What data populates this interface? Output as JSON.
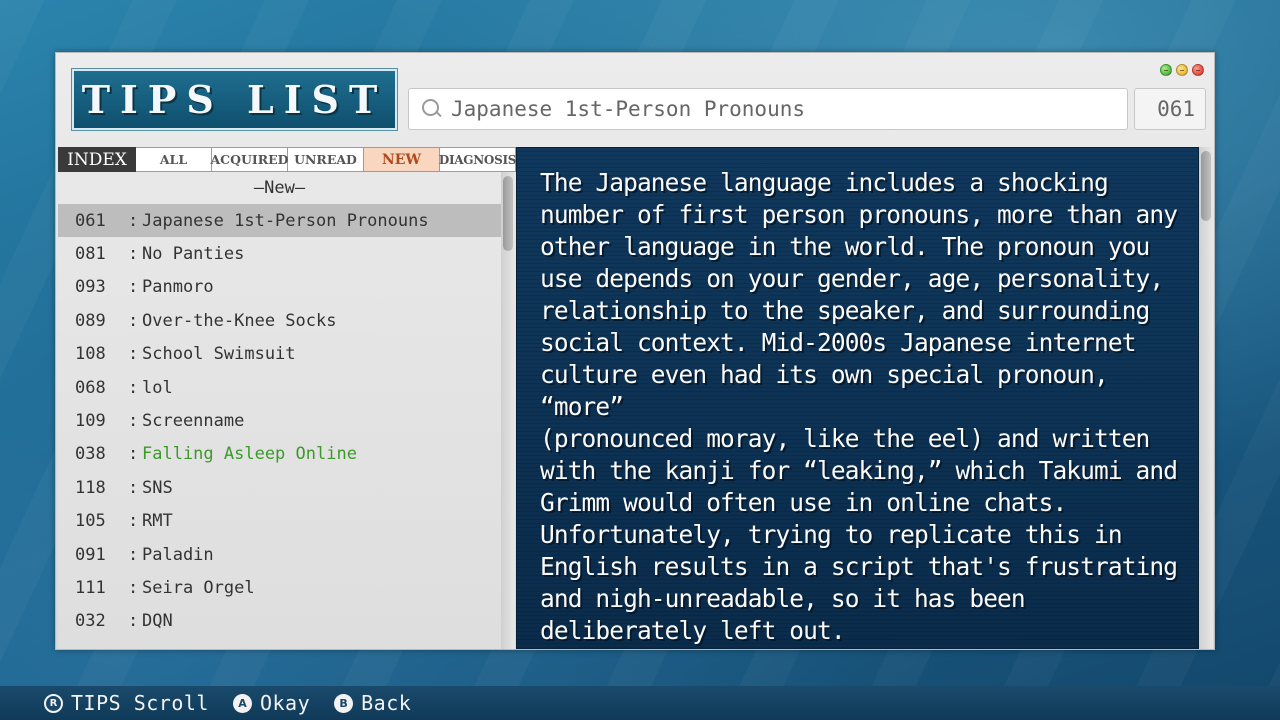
{
  "header": {
    "title": "TIPS LIST",
    "search_value": "Japanese 1st-Person Pronouns",
    "count": "061"
  },
  "tabs": [
    "INDEX",
    "ALL",
    "ACQUIRED",
    "UNREAD",
    "NEW",
    "DIAGNOSIS"
  ],
  "active_tab": "NEW",
  "list": {
    "section_header": "—New—",
    "separator": ":",
    "items": [
      {
        "num": "061",
        "title": "Japanese 1st-Person Pronouns"
      },
      {
        "num": "081",
        "title": "No Panties"
      },
      {
        "num": "093",
        "title": "Panmoro"
      },
      {
        "num": "089",
        "title": "Over-the-Knee Socks"
      },
      {
        "num": "108",
        "title": "School Swimsuit"
      },
      {
        "num": "068",
        "title": "lol"
      },
      {
        "num": "109",
        "title": "Screenname"
      },
      {
        "num": "038",
        "title": "Falling Asleep Online"
      },
      {
        "num": "118",
        "title": "SNS"
      },
      {
        "num": "105",
        "title": "RMT"
      },
      {
        "num": "091",
        "title": "Paladin"
      },
      {
        "num": "111",
        "title": "Seira Orgel"
      },
      {
        "num": "032",
        "title": "DQN"
      }
    ]
  },
  "content": {
    "body": "The Japanese language includes a shocking\nnumber of first person pronouns, more than any\nother language in the world. The pronoun you\nuse depends on your gender, age, personality,\nrelationship to the speaker, and surrounding\nsocial context. Mid-2000s Japanese internet\nculture even had its own special pronoun, “more”\n(pronounced moray, like the eel) and written\nwith the kanji for “leaking,” which Takumi and\nGrimm would often use in online chats.\nUnfortunately, trying to replicate this in\nEnglish results in a script that's frustrating\nand nigh-unreadable, so it has been\ndeliberately left out."
  },
  "footer": {
    "hints": [
      {
        "glyph": "R",
        "label": "TIPS Scroll"
      },
      {
        "glyph": "A",
        "label": "Okay"
      },
      {
        "glyph": "B",
        "label": "Back"
      }
    ]
  },
  "colors": {
    "accent_title": "#1f6e8f",
    "active_tab_bg": "#f8d6c0",
    "highlight_text": "#3c9a2a",
    "content_bg": "#0d3152"
  }
}
